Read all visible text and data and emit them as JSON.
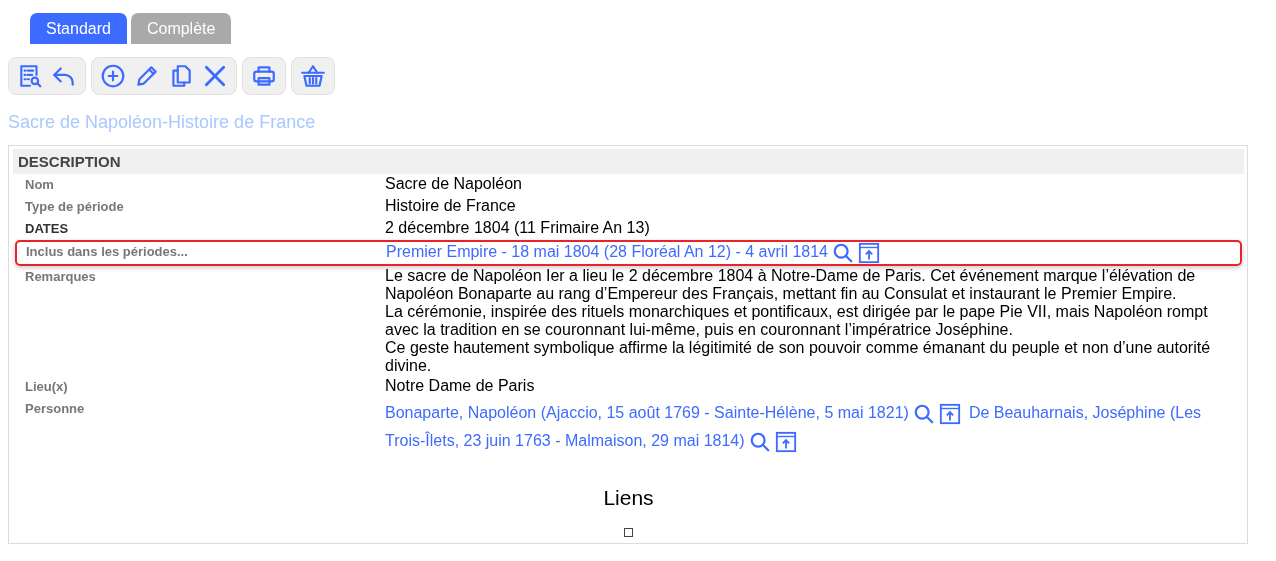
{
  "tabs": [
    {
      "label": "Standard",
      "selected": true
    },
    {
      "label": "Complète",
      "selected": false
    }
  ],
  "page_title": "Sacre de Napoléon-Histoire de France",
  "section": {
    "title": "DESCRIPTION",
    "rows": [
      {
        "label": "Nom",
        "kind": "text",
        "strong_label": false,
        "highlighted": false,
        "value": "Sacre de Napoléon"
      },
      {
        "label": "Type de période",
        "kind": "text",
        "strong_label": false,
        "highlighted": false,
        "value": "Histoire de France"
      },
      {
        "label": "DATES",
        "kind": "text",
        "strong_label": true,
        "highlighted": false,
        "value": "2 décembre 1804 (11 Frimaire An 13)"
      },
      {
        "label": "Inclus dans les périodes...",
        "kind": "links",
        "strong_label": false,
        "highlighted": true,
        "links": [
          {
            "parts": [
              "Premier Empire - 18 mai 1804 (28 Floréal An 12) - 4 avril 1814"
            ]
          }
        ]
      },
      {
        "label": "Remarques",
        "kind": "paragraphs",
        "strong_label": false,
        "highlighted": false,
        "paragraphs": [
          "Le sacre de Napoléon Ier a lieu le 2 décembre 1804 à Notre-Dame de Paris. Cet événement marque l’élévation de Napoléon Bonaparte au rang d’Empereur des Français, mettant fin au Consulat et instaurant le Premier Empire.",
          "La cérémonie, inspirée des rituels monarchiques et pontificaux, est dirigée par le pape Pie VII, mais Napoléon rompt avec la tradition en se couronnant lui-même, puis en couronnant l’impératrice Joséphine.",
          "Ce geste hautement symbolique affirme la légitimité de son pouvoir comme émanant du peuple et non d’une autorité divine."
        ]
      },
      {
        "label": "Lieu(x)",
        "kind": "text",
        "strong_label": false,
        "highlighted": false,
        "value": "Notre Dame de Paris"
      },
      {
        "label": "Personne",
        "kind": "links",
        "strong_label": false,
        "highlighted": false,
        "links": [
          {
            "parts": [
              "Bonaparte, Napoléon (Ajaccio, 15 août 1769 - Sainte-Hélène, 5 mai 1821)"
            ]
          },
          {
            "parts": [
              "De Beauharnais, Joséphine (Les",
              "Trois-Îlets, 23 juin 1763 - Malmaison, 29 mai 1814)"
            ]
          }
        ]
      }
    ]
  },
  "links_section": {
    "title": "Liens",
    "checked": false
  }
}
